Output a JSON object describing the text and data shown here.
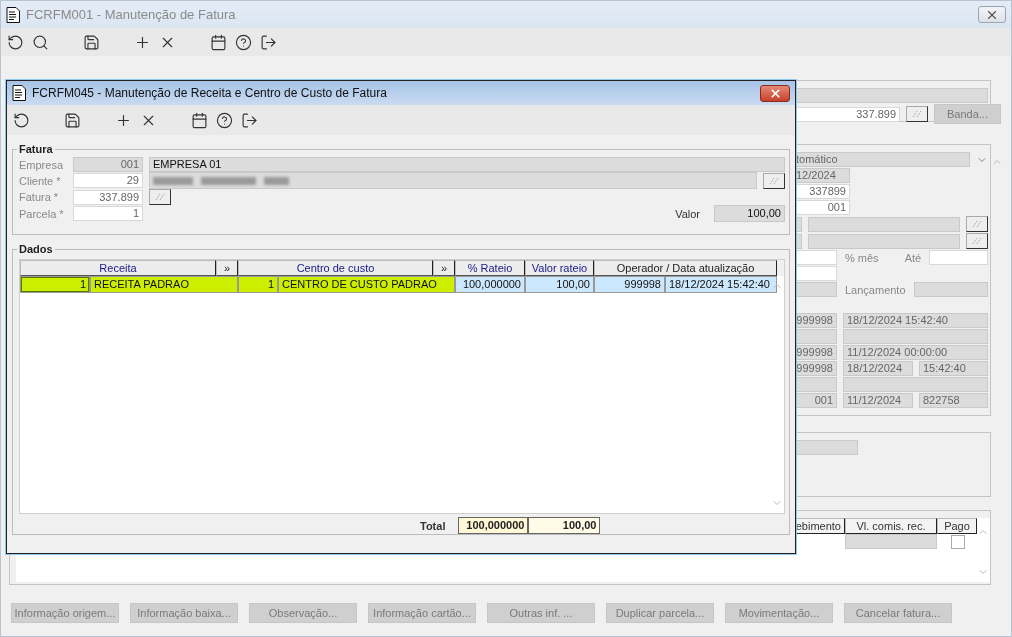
{
  "main_window": {
    "title": "FCRFM001 - Manutenção de Fatura",
    "fatura_number": "337.899",
    "banda_button": {
      "label": "Banda...",
      "disabled": true
    },
    "type_select": "tomático",
    "date_field": "12/2024",
    "number_field": "337899",
    "parcel_field": "001",
    "labels": {
      "percent_month": "% mês",
      "until": "Até",
      "posting": "Lançamento"
    },
    "audit_rows": [
      {
        "kind": "datetime",
        "operator": "999998",
        "date": "18/12/2024 15:42:40"
      },
      {
        "kind": "empty"
      },
      {
        "kind": "datetime",
        "operator": "999998",
        "date": "11/12/2024 00:00:00"
      },
      {
        "kind": "split",
        "operator": "999998",
        "date": "18/12/2024",
        "time": "15:42:40"
      },
      {
        "kind": "empty"
      },
      {
        "kind": "split",
        "operator": "001",
        "date": "11/12/2024",
        "time": "822758"
      }
    ],
    "commission_grid": {
      "columns": [
        "ebimento",
        "Vl. comis. rec.",
        "Pago"
      ],
      "paid_checked": false
    },
    "buttons": [
      {
        "label": "Informação origem...",
        "disabled": true
      },
      {
        "label": "Informação baixa...",
        "disabled": true
      },
      {
        "label": "Observação...",
        "disabled": true
      },
      {
        "label": "Informação cartão...",
        "disabled": true
      },
      {
        "label": "Outras inf. ...",
        "disabled": true
      },
      {
        "label": "Duplicar parcela...",
        "disabled": true
      },
      {
        "label": "Movimentação...",
        "disabled": true
      },
      {
        "label": "Cancelar fatura...",
        "disabled": true
      }
    ]
  },
  "dialog": {
    "title": "FCRFM045 - Manutenção de Receita e Centro de Custo de Fatura",
    "fatura": {
      "legend": "Fatura",
      "empresa_label": "Empresa",
      "empresa_code": "001",
      "empresa_name": "EMPRESA 01",
      "cliente_label": "Cliente *",
      "cliente_code": "29",
      "fatura_label": "Fatura *",
      "fatura_value": "337.899",
      "parcela_label": "Parcela *",
      "parcela_value": "1",
      "valor_label": "Valor",
      "valor_value": "100,00"
    },
    "dados": {
      "legend": "Dados",
      "columns": [
        "Receita",
        "»",
        "Centro de custo",
        "»",
        "% Rateio",
        "Valor rateio",
        "Operador / Data atualização"
      ],
      "rows": [
        {
          "selected": true,
          "receita_code": "1",
          "receita": "RECEITA PADRAO",
          "centro_code": "1",
          "centro": "CENTRO DE CUSTO PADRAO",
          "rateio_pct": "100,000000",
          "valor_rateio": "100,00",
          "operador": "999998",
          "data": "18/12/2024 15:42:40"
        }
      ],
      "total_label": "Total",
      "total_pct": "100,000000",
      "total_valor": "100,00"
    }
  }
}
